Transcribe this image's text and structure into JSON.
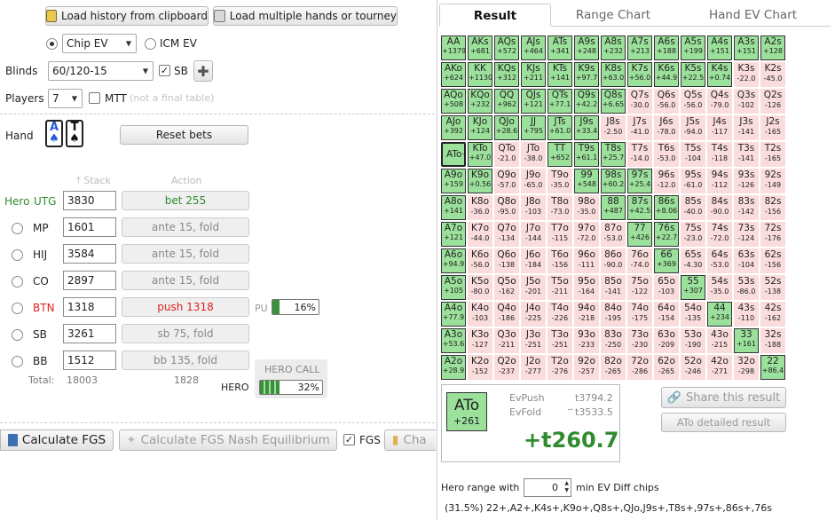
{
  "toolbar": {
    "load_history_label": "Load history from clipboard",
    "load_multiple_label": "Load multiple hands or tourney"
  },
  "ev_mode": {
    "options": [
      {
        "label": "Chip EV",
        "checked": true
      },
      {
        "label": "ICM EV",
        "checked": false
      }
    ],
    "chip_ev_select_value": "Chip EV"
  },
  "blinds": {
    "label": "Blinds",
    "value": "60/120-15",
    "sb_label": "SB",
    "sb_checked": true
  },
  "players": {
    "label": "Players",
    "value": "7",
    "mtt_label": "MTT",
    "mtt_hint": "(not a final table)",
    "mtt_checked": false
  },
  "hand": {
    "label": "Hand",
    "cards": [
      {
        "rank": "A",
        "suit": "♠",
        "suit_color": "#2a5bd7"
      },
      {
        "rank": "T",
        "suit": "♠",
        "suit_color": "#111111"
      }
    ],
    "reset_label": "Reset bets"
  },
  "table_headers": {
    "stack": "Stack",
    "action": "Action"
  },
  "players_list": [
    {
      "pos": "UTG",
      "prefix": "Hero",
      "stack": "3830",
      "action": "bet 255",
      "highlight": "hero"
    },
    {
      "pos": "MP",
      "prefix": "",
      "stack": "1601",
      "action": "ante 15, fold",
      "highlight": ""
    },
    {
      "pos": "HIJ",
      "prefix": "",
      "stack": "3584",
      "action": "ante 15, fold",
      "highlight": ""
    },
    {
      "pos": "CO",
      "prefix": "",
      "stack": "2897",
      "action": "ante 15, fold",
      "highlight": ""
    },
    {
      "pos": "BTN",
      "prefix": "",
      "stack": "1318",
      "action": "push 1318",
      "highlight": "push"
    },
    {
      "pos": "SB",
      "prefix": "",
      "stack": "3261",
      "action": "sb 75, fold",
      "highlight": ""
    },
    {
      "pos": "BB",
      "prefix": "",
      "stack": "1512",
      "action": "bb 135, fold",
      "highlight": ""
    }
  ],
  "pu": {
    "label": "PU",
    "percent": "16%",
    "fraction": 0.16
  },
  "totals": {
    "label": "Total:",
    "stack": "18003",
    "action": "1828"
  },
  "hero_call": {
    "title": "HERO CALL",
    "hero_label": "HERO",
    "percent": "32%",
    "fraction": 0.32
  },
  "bottom_buttons": {
    "calculate": "Calculate FGS",
    "nash": "Calculate FGS Nash Equilibrium",
    "fgs_label": "FGS",
    "fgs_checked": true,
    "chart_partial": "Cha"
  },
  "tabs": [
    {
      "label": "Result",
      "active": true
    },
    {
      "label": "Range Chart",
      "active": false
    },
    {
      "label": "Hand EV Chart",
      "active": false
    }
  ],
  "colors": {
    "green_cell": "#9be09b",
    "red_cell": "#fadcdc",
    "hero_green": "#2e8b2e",
    "push_red": "#e02020"
  },
  "grid": [
    [
      [
        "AA",
        "+1379"
      ],
      [
        "AKs",
        "+681"
      ],
      [
        "AQs",
        "+572"
      ],
      [
        "AJs",
        "+464"
      ],
      [
        "ATs",
        "+341"
      ],
      [
        "A9s",
        "+248"
      ],
      [
        "A8s",
        "+232"
      ],
      [
        "A7s",
        "+213"
      ],
      [
        "A6s",
        "+188"
      ],
      [
        "A5s",
        "+199"
      ],
      [
        "A4s",
        "+151"
      ],
      [
        "A3s",
        "+151"
      ],
      [
        "A2s",
        "+128"
      ]
    ],
    [
      [
        "AKo",
        "+624"
      ],
      [
        "KK",
        "+1130"
      ],
      [
        "KQs",
        "+312"
      ],
      [
        "KJs",
        "+211"
      ],
      [
        "KTs",
        "+141"
      ],
      [
        "K9s",
        "+97.7"
      ],
      [
        "K8s",
        "+63.0"
      ],
      [
        "K7s",
        "+56.0"
      ],
      [
        "K6s",
        "+44.9"
      ],
      [
        "K5s",
        "+22.5"
      ],
      [
        "K4s",
        "+0.74"
      ],
      [
        "K3s",
        "-22.0"
      ],
      [
        "K2s",
        "-45.0"
      ]
    ],
    [
      [
        "AQo",
        "+508"
      ],
      [
        "KQo",
        "+232"
      ],
      [
        "QQ",
        "+962"
      ],
      [
        "QJs",
        "+121"
      ],
      [
        "QTs",
        "+77.1"
      ],
      [
        "Q9s",
        "+42.2"
      ],
      [
        "Q8s",
        "+6.65"
      ],
      [
        "Q7s",
        "-30.0"
      ],
      [
        "Q6s",
        "-56.0"
      ],
      [
        "Q5s",
        "-56.0"
      ],
      [
        "Q4s",
        "-79.0"
      ],
      [
        "Q3s",
        "-102"
      ],
      [
        "Q2s",
        "-126"
      ]
    ],
    [
      [
        "AJo",
        "+392"
      ],
      [
        "KJo",
        "+124"
      ],
      [
        "QJo",
        "+28.6"
      ],
      [
        "JJ",
        "+795"
      ],
      [
        "JTs",
        "+61.0"
      ],
      [
        "J9s",
        "+33.4"
      ],
      [
        "J8s",
        "-2.50"
      ],
      [
        "J7s",
        "-41.0"
      ],
      [
        "J6s",
        "-78.0"
      ],
      [
        "J5s",
        "-94.0"
      ],
      [
        "J4s",
        "-117"
      ],
      [
        "J3s",
        "-141"
      ],
      [
        "J2s",
        "-165"
      ]
    ],
    [
      [
        "ATo",
        "+261"
      ],
      [
        "KTo",
        "+47.0"
      ],
      [
        "QTo",
        "-21.0"
      ],
      [
        "JTo",
        "-38.0"
      ],
      [
        "TT",
        "+652"
      ],
      [
        "T9s",
        "+61.1"
      ],
      [
        "T8s",
        "+25.7"
      ],
      [
        "T7s",
        "-14.0"
      ],
      [
        "T6s",
        "-53.0"
      ],
      [
        "T5s",
        "-104"
      ],
      [
        "T4s",
        "-118"
      ],
      [
        "T3s",
        "-141"
      ],
      [
        "T2s",
        "-165"
      ]
    ],
    [
      [
        "A9o",
        "+159"
      ],
      [
        "K9o",
        "+0.56"
      ],
      [
        "Q9o",
        "-57.0"
      ],
      [
        "J9o",
        "-65.0"
      ],
      [
        "T9o",
        "-35.0"
      ],
      [
        "99",
        "+548"
      ],
      [
        "98s",
        "+60.2"
      ],
      [
        "97s",
        "+25.4"
      ],
      [
        "96s",
        "-12.0"
      ],
      [
        "95s",
        "-61.0"
      ],
      [
        "94s",
        "-112"
      ],
      [
        "93s",
        "-126"
      ],
      [
        "92s",
        "-149"
      ]
    ],
    [
      [
        "A8o",
        "+141"
      ],
      [
        "K8o",
        "-36.0"
      ],
      [
        "Q8o",
        "-95.0"
      ],
      [
        "J8o",
        "-103"
      ],
      [
        "T8o",
        "-73.0"
      ],
      [
        "98o",
        "-35.0"
      ],
      [
        "88",
        "+487"
      ],
      [
        "87s",
        "+42.5"
      ],
      [
        "86s",
        "+8.06"
      ],
      [
        "85s",
        "-40.0"
      ],
      [
        "84s",
        "-90.0"
      ],
      [
        "83s",
        "-142"
      ],
      [
        "82s",
        "-156"
      ]
    ],
    [
      [
        "A7o",
        "+121"
      ],
      [
        "K7o",
        "-44.0"
      ],
      [
        "Q7o",
        "-134"
      ],
      [
        "J7o",
        "-144"
      ],
      [
        "T7o",
        "-115"
      ],
      [
        "97o",
        "-72.0"
      ],
      [
        "87o",
        "-53.0"
      ],
      [
        "77",
        "+426"
      ],
      [
        "76s",
        "+22.7"
      ],
      [
        "75s",
        "-23.0"
      ],
      [
        "74s",
        "-72.0"
      ],
      [
        "73s",
        "-124"
      ],
      [
        "72s",
        "-176"
      ]
    ],
    [
      [
        "A6o",
        "+94.9"
      ],
      [
        "K6o",
        "-56.0"
      ],
      [
        "Q6o",
        "-138"
      ],
      [
        "J6o",
        "-184"
      ],
      [
        "T6o",
        "-156"
      ],
      [
        "96o",
        "-111"
      ],
      [
        "86o",
        "-90.0"
      ],
      [
        "76o",
        "-74.0"
      ],
      [
        "66",
        "+369"
      ],
      [
        "65s",
        "-4.30"
      ],
      [
        "64s",
        "-53.0"
      ],
      [
        "63s",
        "-104"
      ],
      [
        "62s",
        "-156"
      ]
    ],
    [
      [
        "A5o",
        "+105"
      ],
      [
        "K5o",
        "-80.0"
      ],
      [
        "Q5o",
        "-162"
      ],
      [
        "J5o",
        "-201"
      ],
      [
        "T5o",
        "-211"
      ],
      [
        "95o",
        "-164"
      ],
      [
        "85o",
        "-141"
      ],
      [
        "75o",
        "-122"
      ],
      [
        "65o",
        "-103"
      ],
      [
        "55",
        "+307"
      ],
      [
        "54s",
        "-35.0"
      ],
      [
        "53s",
        "-86.0"
      ],
      [
        "52s",
        "-138"
      ]
    ],
    [
      [
        "A4o",
        "+77.9"
      ],
      [
        "K4o",
        "-103"
      ],
      [
        "Q4o",
        "-186"
      ],
      [
        "J4o",
        "-225"
      ],
      [
        "T4o",
        "-226"
      ],
      [
        "94o",
        "-218"
      ],
      [
        "84o",
        "-195"
      ],
      [
        "74o",
        "-175"
      ],
      [
        "64o",
        "-154"
      ],
      [
        "54o",
        "-135"
      ],
      [
        "44",
        "+234"
      ],
      [
        "43s",
        "-110"
      ],
      [
        "42s",
        "-162"
      ]
    ],
    [
      [
        "A3o",
        "+53.6"
      ],
      [
        "K3o",
        "-127"
      ],
      [
        "Q3o",
        "-211"
      ],
      [
        "J3o",
        "-251"
      ],
      [
        "T3o",
        "-251"
      ],
      [
        "93o",
        "-233"
      ],
      [
        "83o",
        "-250"
      ],
      [
        "73o",
        "-230"
      ],
      [
        "63o",
        "-209"
      ],
      [
        "53o",
        "-190"
      ],
      [
        "43o",
        "-215"
      ],
      [
        "33",
        "+161"
      ],
      [
        "32s",
        "-188"
      ]
    ],
    [
      [
        "A2o",
        "+28.9"
      ],
      [
        "K2o",
        "-152"
      ],
      [
        "Q2o",
        "-237"
      ],
      [
        "J2o",
        "-277"
      ],
      [
        "T2o",
        "-276"
      ],
      [
        "92o",
        "-257"
      ],
      [
        "82o",
        "-265"
      ],
      [
        "72o",
        "-286"
      ],
      [
        "62o",
        "-265"
      ],
      [
        "52o",
        "-246"
      ],
      [
        "42o",
        "-271"
      ],
      [
        "32o",
        "-298"
      ],
      [
        "22",
        "+86.4"
      ]
    ]
  ],
  "selected_hand": {
    "name": "ATo",
    "ev": "+261"
  },
  "result": {
    "ev_push_label": "EvPush",
    "ev_push_value": "t3794.2",
    "ev_fold_label": "EvFold",
    "ev_fold_value": "t3533.5",
    "dash": "_",
    "diff": "+t260.7"
  },
  "share_label": "Share this result",
  "detail_label": "ATo detailed result",
  "hero_range": {
    "label_before": "Hero range with",
    "value": "0",
    "label_after": "min EV Diff chips",
    "text": "(31.5%) 22+,A2+,K4s+,K9o+,Q8s+,QJo,J9s+,T8s+,97s+,86s+,76s"
  }
}
